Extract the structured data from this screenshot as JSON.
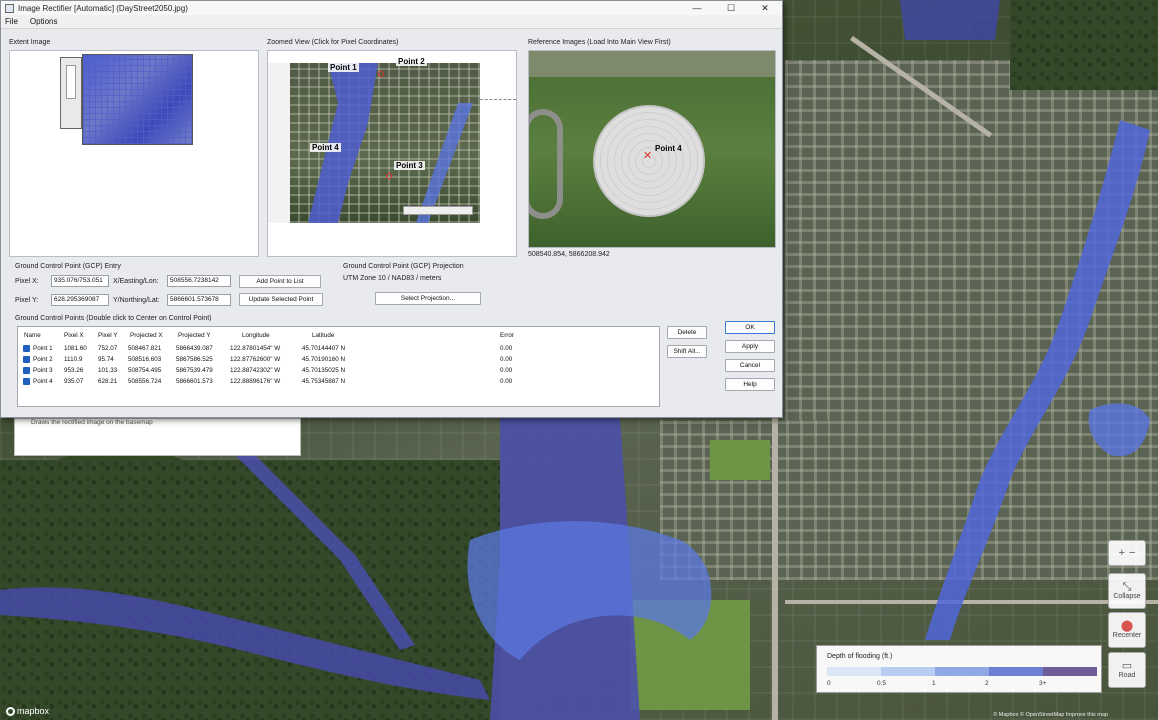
{
  "window": {
    "title": "Image Rectifier [Automatic] (DayStreet2050.jpg)",
    "minimize": "—",
    "maximize": "☐",
    "close": "✕"
  },
  "menu": {
    "items": [
      "File",
      "Options"
    ]
  },
  "panels": {
    "extent_label": "Extent Image",
    "zoomed_label": "Zoomed View (Click for Pixel Coordinates)",
    "reference_label": "Reference Images (Load Into Main View First)",
    "reference_coords": "508540.854, 5866208.942"
  },
  "zoom_points": [
    "Point 1",
    "Point 2",
    "Point 3",
    "Point 4"
  ],
  "reference_point": "Point 4",
  "gcp_entry": {
    "heading": "Ground Control Point (GCP) Entry",
    "pixel_x_label": "Pixel X:",
    "pixel_x_value": "935.076/753.051",
    "pixel_y_label": "Pixel Y:",
    "pixel_y_value": "628.295369087",
    "easting_label": "X/Easting/Lon:",
    "easting_value": "508556.7238142",
    "northing_label": "Y/Northing/Lat:",
    "northing_value": "5866601.573678",
    "add_button": "Add Point to List",
    "update_button": "Update Selected Point"
  },
  "projection": {
    "heading": "Ground Control Point (GCP) Projection",
    "value": "UTM Zone 10 / NAD83 / meters",
    "select_button": "Select Projection..."
  },
  "gcp_table": {
    "heading": "Ground Control Points (Double click to Center on Control Point)",
    "columns": [
      "Name",
      "Pixel X",
      "Pixel Y",
      "Projected X",
      "Projected Y",
      "Longitude",
      "Latitude",
      "Error"
    ],
    "rows": [
      [
        "Point 1",
        "1081.60",
        "752.07",
        "508467.821",
        "5866439.087",
        "122.87801454\" W",
        "45.70144407 N",
        "0.00"
      ],
      [
        "Point 2",
        "1110.9",
        "95.74",
        "508516.603",
        "5867586.525",
        "122.87762600\" W",
        "45.70190160 N",
        "0.00"
      ],
      [
        "Point 3",
        "953.26",
        "101.33",
        "508754.495",
        "5867539.479",
        "122.88742302\" W",
        "45.70135025 N",
        "0.00"
      ],
      [
        "Point 4",
        "935.07",
        "628.21",
        "508556.724",
        "5866601.573",
        "122.88896176\" W",
        "45.75345887 N",
        "0.00"
      ]
    ]
  },
  "side_buttons": {
    "delete": "Delete",
    "shift_all": "Shift All..."
  },
  "dialog_buttons": {
    "ok": "OK",
    "apply": "Apply",
    "cancel": "Cancel",
    "help": "Help"
  },
  "behind_panel_text": "Draws the rectified image on the basemap",
  "map_controls": {
    "zoom_in": "+",
    "zoom_out": "−",
    "collapse": "Collapse",
    "recenter": "Recenter",
    "road": "Road"
  },
  "legend": {
    "title": "Depth of flooding (ft.)",
    "ticks": [
      "0",
      "0.5",
      "1",
      "2",
      "3+"
    ],
    "colors": [
      "#dbe6f7",
      "#b9cdf2",
      "#8ea8e6",
      "#6d7fd4",
      "#6e5e98"
    ]
  },
  "attribution": "© Mapbox © OpenStreetMap Improve this map",
  "mapbox_logo": "mapbox",
  "colors": {
    "flood_light": "#6d84e3",
    "flood_dark": "#4b4fb0",
    "dialog_bg": "#e8eaee"
  }
}
